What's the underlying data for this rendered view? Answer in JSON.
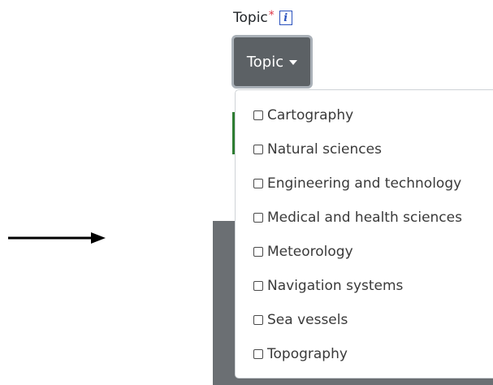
{
  "field": {
    "label": "Topic",
    "required_mark": "*",
    "info_icon": "i"
  },
  "dropdown": {
    "toggle_label": "Topic",
    "items": [
      {
        "label": "Cartography",
        "checked": false
      },
      {
        "label": "Natural sciences",
        "checked": false
      },
      {
        "label": "Engineering and technology",
        "checked": false
      },
      {
        "label": "Medical and health sciences",
        "checked": false
      },
      {
        "label": "Meteorology",
        "checked": false
      },
      {
        "label": "Navigation systems",
        "checked": false
      },
      {
        "label": "Sea vessels",
        "checked": false
      },
      {
        "label": "Topography",
        "checked": false
      }
    ]
  },
  "annotation": {
    "icon": "arrow-right-icon"
  },
  "colors": {
    "toggle_bg": "#5c6165",
    "toggle_border": "#a9b0b7",
    "required": "#dc3545",
    "info": "#2a52be",
    "panel_bg": "#6b6f73",
    "green_accent": "#2e7d32"
  }
}
